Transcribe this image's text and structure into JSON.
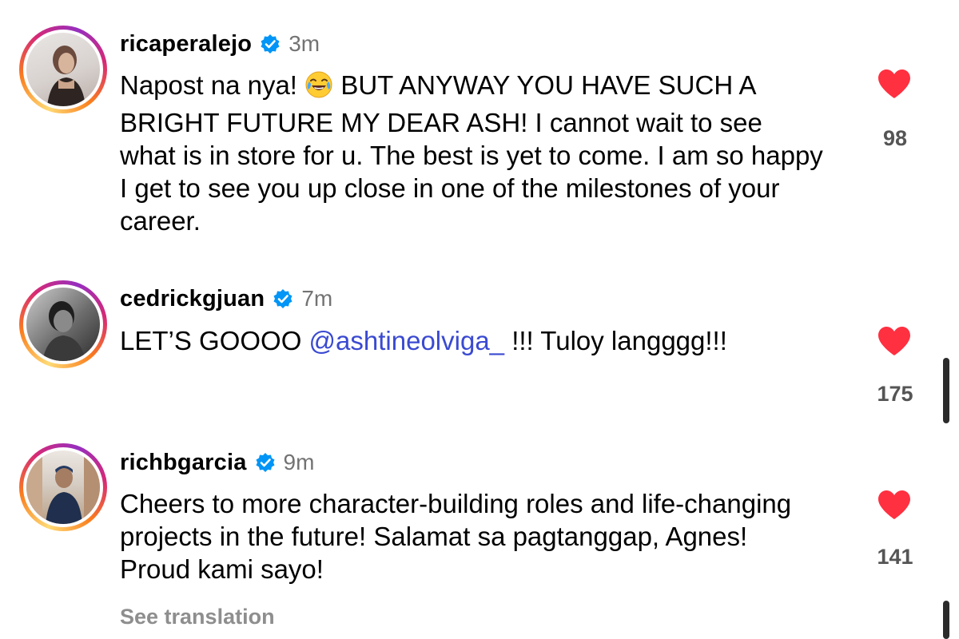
{
  "comments": [
    {
      "username": "ricaperalejo",
      "time": "3m",
      "text_before": "Napost na nya! ",
      "emoji": "😂",
      "text_after": " BUT ANYWAY YOU HAVE SUCH A BRIGHT FUTURE MY DEAR ASH! I cannot wait to see what is in store for u. The best is yet to come. I am so happy I get to see you up close in one of the milestones of your career.",
      "likes": "98"
    },
    {
      "username": "cedrickgjuan",
      "time": "7m",
      "text_before": "LET’S GOOOO ",
      "mention": "@ashtineolviga_",
      "text_after": " !!! Tuloy langggg!!!",
      "likes": "175"
    },
    {
      "username": "richbgarcia",
      "time": "9m",
      "text": "Cheers to more character-building roles and life-changing projects in the future! Salamat sa pagtanggap, Agnes! Proud kami sayo!",
      "likes": "141",
      "see_translation": "See translation"
    }
  ],
  "icons": {
    "verified": "verified-badge-icon",
    "like": "heart-icon"
  },
  "colors": {
    "heart": "#ff3040",
    "verified": "#0095f6",
    "mention": "#3a4ad1"
  }
}
